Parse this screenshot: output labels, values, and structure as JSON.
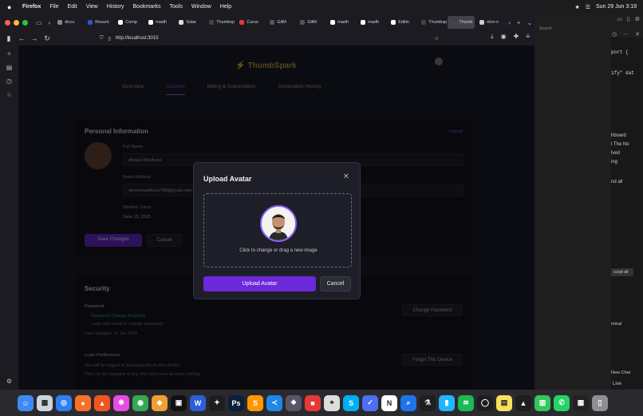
{
  "menubar": {
    "app": "Firefox",
    "items": [
      "File",
      "Edit",
      "View",
      "History",
      "Bookmarks",
      "Tools",
      "Window",
      "Help"
    ],
    "clock": "Sun 29 Jun 3:19"
  },
  "tabs": [
    {
      "label": "docu",
      "color": "#888888"
    },
    {
      "label": "Resum",
      "color": "#2b59c3"
    },
    {
      "label": "Comp",
      "color": "#ffffff"
    },
    {
      "label": "madh",
      "color": "#ffffff"
    },
    {
      "label": "Solar",
      "color": "#dddddd"
    },
    {
      "label": "Thumbsp",
      "color": "#444444"
    },
    {
      "label": "Curso",
      "color": "#e53935"
    },
    {
      "label": "GitM",
      "color": "#555555"
    },
    {
      "label": "GitM",
      "color": "#555555"
    },
    {
      "label": "madh",
      "color": "#ffffff"
    },
    {
      "label": "madh",
      "color": "#ffffff"
    },
    {
      "label": "Editin",
      "color": "#ffffff"
    },
    {
      "label": "Thumbsp",
      "color": "#444444"
    },
    {
      "label": "Thumb",
      "color": "#444444",
      "active": true
    },
    {
      "label": "elon n",
      "color": "#cccccc"
    }
  ],
  "navbar": {
    "url": "http://localhost:3015"
  },
  "app": {
    "logo": "ThumbSpark",
    "tabs": [
      "Overview",
      "Account",
      "Billing & Subscription",
      "Generation History"
    ],
    "personal_info": {
      "title": "Personal Information",
      "edit": "Cancel",
      "full_name_label": "Full Name",
      "full_name": "Ahmed Madhuns",
      "email_label": "Email Address",
      "email": "ahmedmadhuns798@gmail.com",
      "member_since_label": "Member Since",
      "member_since": "June 15, 2025",
      "save": "Save Changes",
      "cancel": "Cancel"
    },
    "security": {
      "title": "Security",
      "password_label": "Password",
      "password_status": "Password Change Available",
      "password_note": "Login with email to change password",
      "password_date": "Last changed: 15 Jun 2025",
      "change_password": "Change Password",
      "login_pref_label": "Login Preferences",
      "login_pref_text": "You will be logged in automatically on this device",
      "login_pref_note": "This can be changed at any time from your account settings",
      "forget_device": "Forget This Device"
    }
  },
  "modal": {
    "title": "Upload Avatar",
    "hint": "Click to change or drag a new image",
    "upload": "Upload Avatar",
    "cancel": "Cancel"
  },
  "editor": {
    "search_placeholder": "Search",
    "code_lines": [
      "port {",
      "ify\" dat"
    ],
    "chat_lines": [
      "hboard",
      "l The No",
      "lved",
      "ing",
      "nd all"
    ],
    "accept_all": "ccept all",
    "terminal": "minal",
    "new_chat": "New Chat",
    "live": "Live"
  },
  "dock": [
    {
      "name": "finder",
      "color": "#3d8af7",
      "glyph": "☺"
    },
    {
      "name": "launchpad",
      "color": "#cfd4dc",
      "glyph": "▦"
    },
    {
      "name": "safari",
      "color": "#2f7ff0",
      "glyph": "◎"
    },
    {
      "name": "firefox",
      "color": "#f7712a",
      "glyph": "●"
    },
    {
      "name": "brave",
      "color": "#f25522",
      "glyph": "▲"
    },
    {
      "name": "lasso",
      "color": "#e84be0",
      "glyph": "✱"
    },
    {
      "name": "chrome",
      "color": "#34a853",
      "glyph": "◉"
    },
    {
      "name": "sublime",
      "color": "#f0a030",
      "glyph": "◆"
    },
    {
      "name": "cursor",
      "color": "#111111",
      "glyph": "▣"
    },
    {
      "name": "word",
      "color": "#2b5fd9",
      "glyph": "W"
    },
    {
      "name": "figma",
      "color": "#1e1e1e",
      "glyph": "✦"
    },
    {
      "name": "photoshop",
      "color": "#0b1f3a",
      "glyph": "Ps"
    },
    {
      "name": "sublime-text",
      "color": "#ff9800",
      "glyph": "S"
    },
    {
      "name": "vscode",
      "color": "#1e88e5",
      "glyph": "≺"
    },
    {
      "name": "mongodb",
      "color": "#556",
      "glyph": "❖"
    },
    {
      "name": "stack",
      "color": "#e53935",
      "glyph": "■"
    },
    {
      "name": "preview",
      "color": "#dddddd",
      "glyph": "⌖"
    },
    {
      "name": "skype",
      "color": "#00aff0",
      "glyph": "S"
    },
    {
      "name": "vpn",
      "color": "#4d6ef5",
      "glyph": "✓"
    },
    {
      "name": "notion",
      "color": "#ffffff",
      "glyph": "N"
    },
    {
      "name": "finder-search",
      "color": "#1e73e8",
      "glyph": "⌕"
    },
    {
      "name": "activity",
      "color": "#1e1e1e",
      "glyph": "⚗"
    },
    {
      "name": "intellij",
      "color": "#1fb6ff",
      "glyph": "▮"
    },
    {
      "name": "spotify",
      "color": "#1db954",
      "glyph": "≋"
    },
    {
      "name": "chatgpt",
      "color": "#1e1e1e",
      "glyph": "◯"
    },
    {
      "name": "notes",
      "color": "#f6e05e",
      "glyph": "▤"
    },
    {
      "name": "arc",
      "color": "#1e1e1e",
      "glyph": "▲"
    },
    {
      "name": "numbers",
      "color": "#34c759",
      "glyph": "▥"
    },
    {
      "name": "whatsapp",
      "color": "#25d366",
      "glyph": "✆"
    },
    {
      "name": "screen-capture",
      "color": "#222222",
      "glyph": "▦"
    },
    {
      "name": "trash",
      "color": "#8e8e93",
      "glyph": "▯"
    }
  ]
}
